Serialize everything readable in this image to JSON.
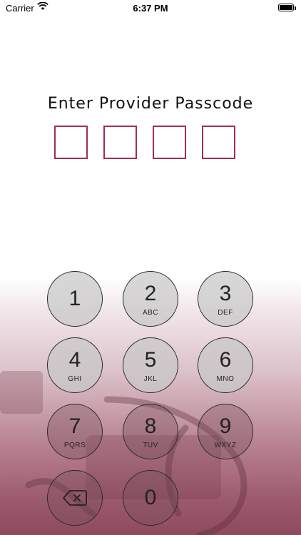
{
  "status_bar": {
    "carrier": "Carrier",
    "time": "6:37 PM",
    "wifi_icon": "wifi-icon",
    "battery_icon": "battery-icon"
  },
  "prompt": {
    "title": "Enter Provider Passcode",
    "code_slots": 4
  },
  "keypad": {
    "keys": [
      {
        "digit": "1",
        "letters": ""
      },
      {
        "digit": "2",
        "letters": "ABC"
      },
      {
        "digit": "3",
        "letters": "DEF"
      },
      {
        "digit": "4",
        "letters": "GHI"
      },
      {
        "digit": "5",
        "letters": "JKL"
      },
      {
        "digit": "6",
        "letters": "MNO"
      },
      {
        "digit": "7",
        "letters": "PQRS"
      },
      {
        "digit": "8",
        "letters": "TUV"
      },
      {
        "digit": "9",
        "letters": "WXYZ"
      },
      {
        "digit": "0",
        "letters": ""
      }
    ],
    "delete_icon": "backspace-icon"
  },
  "colors": {
    "accent": "#a0304e",
    "background_tint": "#8e4b5e"
  }
}
